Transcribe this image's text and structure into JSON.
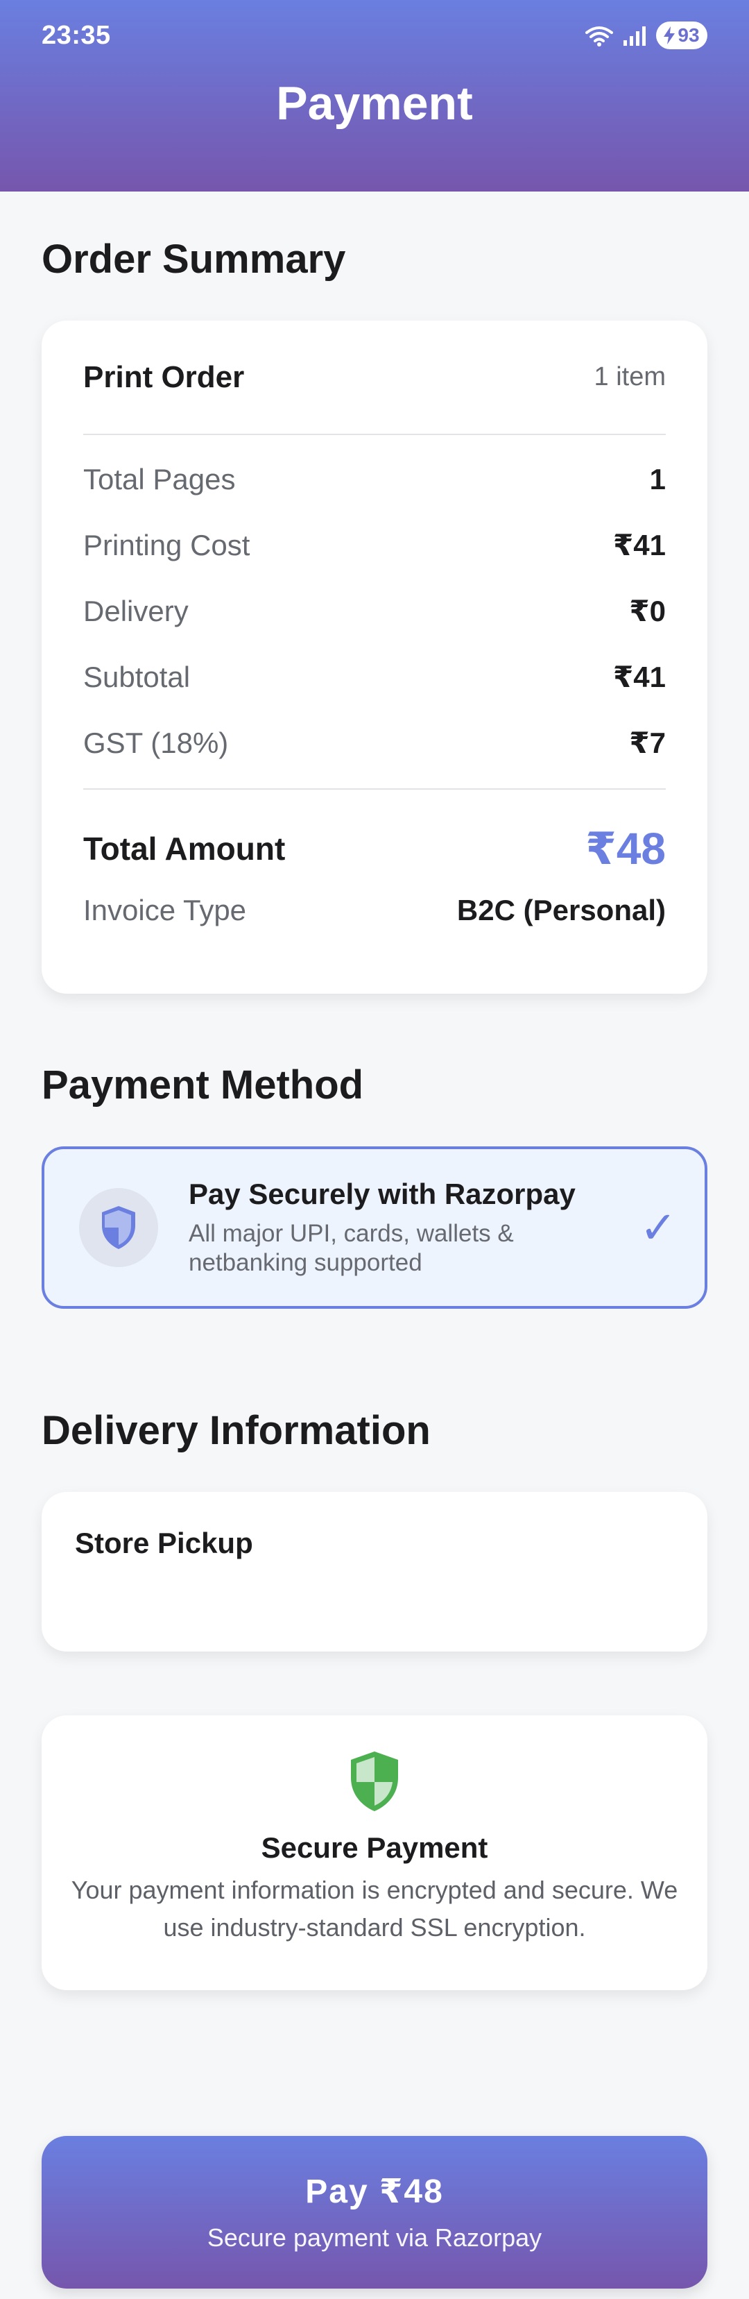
{
  "status_bar": {
    "time": "23:35",
    "battery": "93"
  },
  "header": {
    "title": "Payment"
  },
  "order_summary": {
    "section_title": "Order Summary",
    "order_name": "Print Order",
    "item_count": "1 item",
    "rows": [
      {
        "label": "Total Pages",
        "value": "1"
      },
      {
        "label": "Printing Cost",
        "value": "₹41"
      },
      {
        "label": "Delivery",
        "value": "₹0"
      },
      {
        "label": "Subtotal",
        "value": "₹41"
      },
      {
        "label": "GST (18%)",
        "value": "₹7"
      }
    ],
    "total_label": "Total Amount",
    "total_value": "₹48",
    "invoice_label": "Invoice Type",
    "invoice_value": "B2C (Personal)"
  },
  "payment_method": {
    "section_title": "Payment Method",
    "title": "Pay Securely with Razorpay",
    "subtitle": "All major UPI, cards, wallets & netbanking supported",
    "selected": true,
    "icon": "shield-icon"
  },
  "delivery": {
    "section_title": "Delivery Information",
    "method": "Store Pickup"
  },
  "secure_info": {
    "title": "Secure Payment",
    "description": "Your payment information is encrypted and secure. We use industry-standard SSL encryption.",
    "icon": "shield-icon"
  },
  "pay_button": {
    "label": "Pay ₹48",
    "sublabel": "Secure payment via Razorpay"
  },
  "colors": {
    "accent": "#6a7fe0",
    "gradient_end": "#7656ad",
    "secure_green": "#4caf50"
  }
}
